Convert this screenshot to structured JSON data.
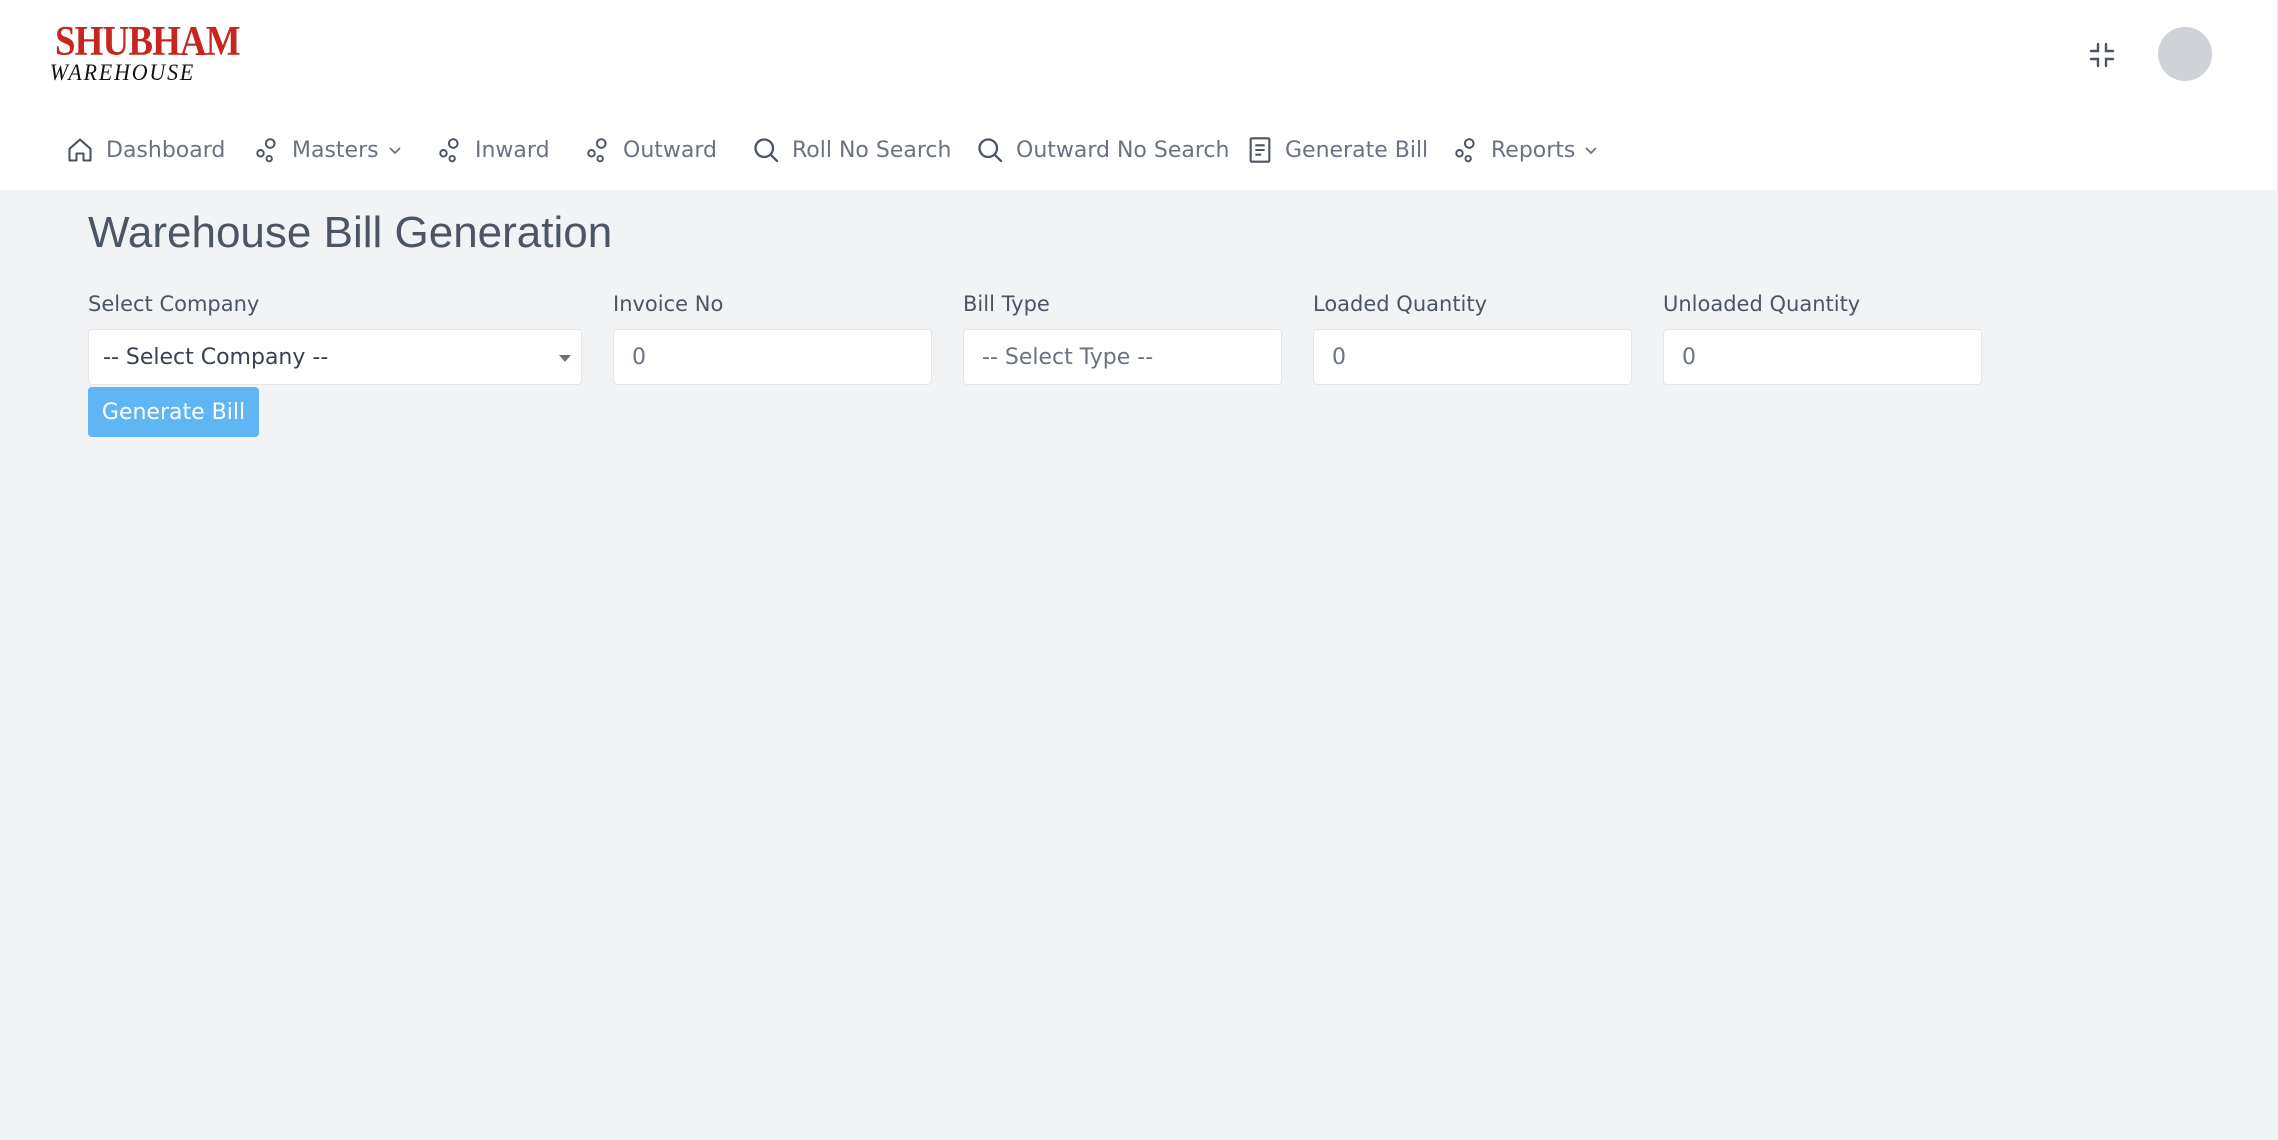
{
  "brand": {
    "name_top": "SHUBHAM",
    "name_bottom": "WAREHOUSE",
    "color_top": "#c8251f",
    "color_bottom": "#111111"
  },
  "header": {
    "fullscreen_icon": "exit-fullscreen-icon",
    "avatar_icon": "user-avatar"
  },
  "nav": {
    "items": [
      {
        "label": "Dashboard",
        "icon": "home-icon"
      },
      {
        "label": "Masters",
        "icon": "nodes-icon",
        "has_dropdown": true
      },
      {
        "label": "Inward",
        "icon": "nodes-icon"
      },
      {
        "label": "Outward",
        "icon": "nodes-icon"
      },
      {
        "label": "Roll No Search",
        "icon": "search-icon"
      },
      {
        "label": "Outward No Search",
        "icon": "search-icon"
      },
      {
        "label": "Generate Bill",
        "icon": "document-icon"
      },
      {
        "label": "Reports",
        "icon": "nodes-icon",
        "has_dropdown": true
      }
    ]
  },
  "main": {
    "title": "Warehouse Bill Generation",
    "fields": {
      "company": {
        "label": "Select Company",
        "value": "-- Select Company --"
      },
      "invoice": {
        "label": "Invoice No",
        "value": "0"
      },
      "bill_type": {
        "label": "Bill Type",
        "value": "-- Select Type --"
      },
      "loaded": {
        "label": "Loaded Quantity",
        "value": "0"
      },
      "unloaded": {
        "label": "Unloaded Quantity",
        "value": "0"
      }
    },
    "generate_button": "Generate Bill"
  },
  "colors": {
    "accent_button": "#60b6f5",
    "page_background": "#f2f3f5"
  }
}
